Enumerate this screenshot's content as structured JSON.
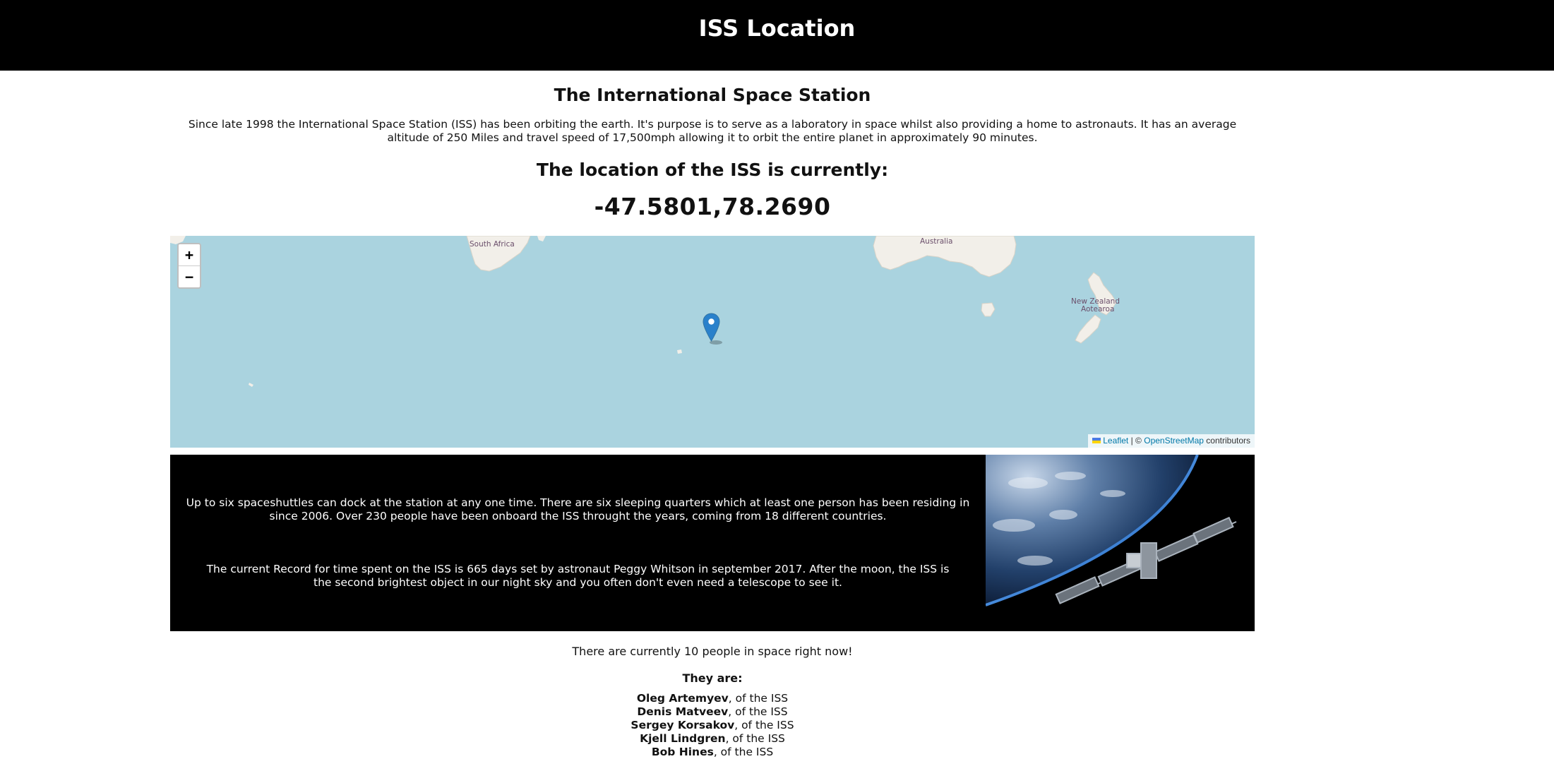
{
  "header": {
    "title": "ISS Location"
  },
  "intro": {
    "title": "The International Space Station",
    "text": "Since late 1998 the International Space Station (ISS) has been orbiting the earth. It's purpose is to serve as a laboratory in space whilst also providing a home to astronauts. It has an average altitude of 250 Miles and travel speed of 17,500mph allowing it to orbit the entire planet in approximately 90 minutes."
  },
  "location": {
    "heading": "The location of the ISS is currently:",
    "coords": "-47.5801,78.2690"
  },
  "map": {
    "zoom_in": "+",
    "zoom_out": "−",
    "labels": {
      "south_africa": "South Africa",
      "australia": "Australia",
      "new_zealand_1": "New Zealand",
      "new_zealand_2": "Aotearoa"
    },
    "attribution": {
      "leaflet": "Leaflet",
      "separator": "| ©",
      "osm": "OpenStreetMap",
      "suffix": "contributors"
    },
    "colors": {
      "water": "#aad3df",
      "land": "#f2efe9",
      "marker": "#2a81cb"
    },
    "marker_icon": "map-pin-icon"
  },
  "facts": {
    "p1": "Up to six spaceshuttles can dock at the station at any one time. There are six sleeping quarters which at least one person has been residing in since 2006. Over 230 people have been onboard the ISS throught the years, coming from 18 different countries.",
    "p2": "The current Record for time spent on the ISS is 665 days set by astronaut Peggy Whitson in september 2017. After the moon, the ISS is the second brightest object in our night sky and you often don't even need a telescope to see it."
  },
  "people": {
    "count_text": "There are currently 10 people in space right now!",
    "heading": "They are:",
    "list": [
      {
        "name": "Oleg Artemyev",
        "craft": ", of the ISS"
      },
      {
        "name": "Denis Matveev",
        "craft": ", of the ISS"
      },
      {
        "name": "Sergey Korsakov",
        "craft": ", of the ISS"
      },
      {
        "name": "Kjell Lindgren",
        "craft": ", of the ISS"
      },
      {
        "name": "Bob Hines",
        "craft": ", of the ISS"
      }
    ]
  }
}
